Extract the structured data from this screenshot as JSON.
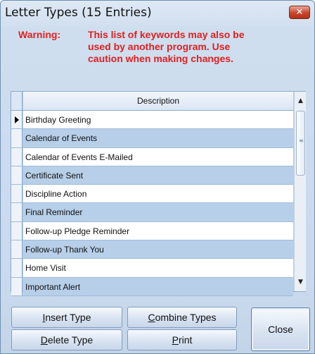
{
  "window": {
    "title": "Letter Types (15 Entries)",
    "close_glyph": "✕"
  },
  "warning": {
    "label": "Warning:",
    "lines": [
      "This list of keywords may also be",
      "used by another program. Use",
      "caution when making changes."
    ]
  },
  "grid": {
    "column_header": "Description",
    "current_row_index": 0,
    "rows": [
      "Birthday Greeting",
      "Calendar of Events",
      "Calendar of Events E-Mailed",
      "Certificate Sent",
      "Discipline Action",
      "Final Reminder",
      "Follow-up Pledge Reminder",
      "Follow-up Thank You",
      "Home Visit",
      "Important Alert"
    ]
  },
  "scrollbar": {
    "up_glyph": "▲",
    "down_glyph": "▼",
    "grip_glyph": "≡"
  },
  "buttons": {
    "insert": {
      "mnemonic": "I",
      "rest": "nsert Type"
    },
    "delete": {
      "mnemonic": "D",
      "rest": "elete Type"
    },
    "combine": {
      "mnemonic": "C",
      "rest": "ombine Types"
    },
    "print": {
      "mnemonic": "P",
      "rest": "rint"
    },
    "close": "Close"
  },
  "colors": {
    "warning": "#e02020",
    "row_alt": "#b7cfe8",
    "accent": "#7f9cbf"
  }
}
